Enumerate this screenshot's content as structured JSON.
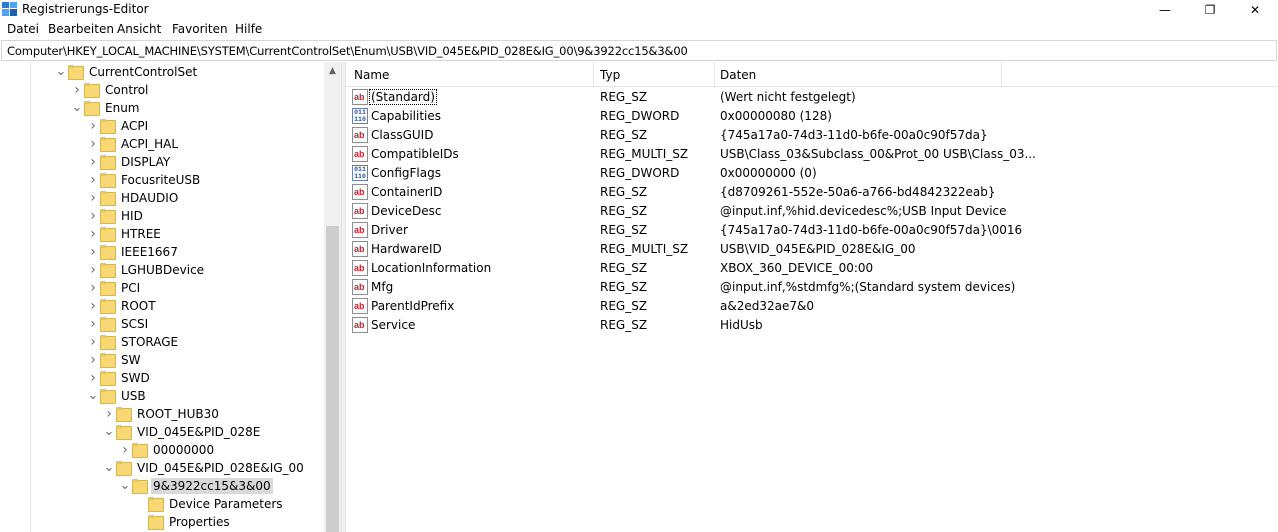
{
  "window": {
    "title": "Registrierungs-Editor",
    "minimize_glyph": "—",
    "maximize_glyph": "❐",
    "close_glyph": "✕",
    "icon": "regedit-icon"
  },
  "menu": [
    "Datei",
    "Bearbeiten",
    "Ansicht",
    "Favoriten",
    "Hilfe"
  ],
  "address": "Computer\\HKEY_LOCAL_MACHINE\\SYSTEM\\CurrentControlSet\\Enum\\USB\\VID_045E&PID_028E&IG_00\\9&3922cc15&3&00",
  "tree": [
    {
      "label": "CurrentControlSet",
      "expanded": true
    },
    {
      "label": "Control",
      "expanded": false
    },
    {
      "label": "Enum",
      "expanded": true
    },
    {
      "label": "ACPI",
      "expanded": false
    },
    {
      "label": "ACPI_HAL",
      "expanded": false
    },
    {
      "label": "DISPLAY",
      "expanded": false
    },
    {
      "label": "FocusriteUSB",
      "expanded": false
    },
    {
      "label": "HDAUDIO",
      "expanded": false
    },
    {
      "label": "HID",
      "expanded": false
    },
    {
      "label": "HTREE",
      "expanded": false
    },
    {
      "label": "IEEE1667",
      "expanded": false
    },
    {
      "label": "LGHUBDevice",
      "expanded": false
    },
    {
      "label": "PCI",
      "expanded": false
    },
    {
      "label": "ROOT",
      "expanded": false
    },
    {
      "label": "SCSI",
      "expanded": false
    },
    {
      "label": "STORAGE",
      "expanded": false
    },
    {
      "label": "SW",
      "expanded": false
    },
    {
      "label": "SWD",
      "expanded": false
    },
    {
      "label": "USB",
      "expanded": true
    },
    {
      "label": "ROOT_HUB30",
      "expanded": false
    },
    {
      "label": "VID_045E&PID_028E",
      "expanded": true
    },
    {
      "label": "00000000",
      "expanded": false
    },
    {
      "label": "VID_045E&PID_028E&IG_00",
      "expanded": true
    },
    {
      "label": "9&3922cc15&3&00",
      "expanded": true,
      "selected": true
    },
    {
      "label": "Device Parameters",
      "leaf": true
    },
    {
      "label": "Properties",
      "leaf": true
    }
  ],
  "columns": {
    "name": "Name",
    "type": "Typ",
    "data": "Daten"
  },
  "values": [
    {
      "name": "(Standard)",
      "type": "REG_SZ",
      "data": "(Wert nicht festgelegt)",
      "icon": "string-value-icon"
    },
    {
      "name": "Capabilities",
      "type": "REG_DWORD",
      "data": "0x00000080 (128)",
      "icon": "dword-value-icon"
    },
    {
      "name": "ClassGUID",
      "type": "REG_SZ",
      "data": "{745a17a0-74d3-11d0-b6fe-00a0c90f57da}",
      "icon": "string-value-icon"
    },
    {
      "name": "CompatibleIDs",
      "type": "REG_MULTI_SZ",
      "data": "USB\\Class_03&Subclass_00&Prot_00 USB\\Class_03...",
      "icon": "string-value-icon"
    },
    {
      "name": "ConfigFlags",
      "type": "REG_DWORD",
      "data": "0x00000000 (0)",
      "icon": "dword-value-icon"
    },
    {
      "name": "ContainerID",
      "type": "REG_SZ",
      "data": "{d8709261-552e-50a6-a766-bd4842322eab}",
      "icon": "string-value-icon"
    },
    {
      "name": "DeviceDesc",
      "type": "REG_SZ",
      "data": "@input.inf,%hid.devicedesc%;USB Input Device",
      "icon": "string-value-icon"
    },
    {
      "name": "Driver",
      "type": "REG_SZ",
      "data": "{745a17a0-74d3-11d0-b6fe-00a0c90f57da}\\0016",
      "icon": "string-value-icon"
    },
    {
      "name": "HardwareID",
      "type": "REG_MULTI_SZ",
      "data": "USB\\VID_045E&PID_028E&IG_00",
      "icon": "string-value-icon"
    },
    {
      "name": "LocationInformation",
      "type": "REG_SZ",
      "data": "XBOX_360_DEVICE_00:00",
      "icon": "string-value-icon"
    },
    {
      "name": "Mfg",
      "type": "REG_SZ",
      "data": "@input.inf,%stdmfg%;(Standard system devices)",
      "icon": "string-value-icon"
    },
    {
      "name": "ParentIdPrefix",
      "type": "REG_SZ",
      "data": "a&2ed32ae7&0",
      "icon": "string-value-icon"
    },
    {
      "name": "Service",
      "type": "REG_SZ",
      "data": "HidUsb",
      "icon": "string-value-icon"
    }
  ]
}
